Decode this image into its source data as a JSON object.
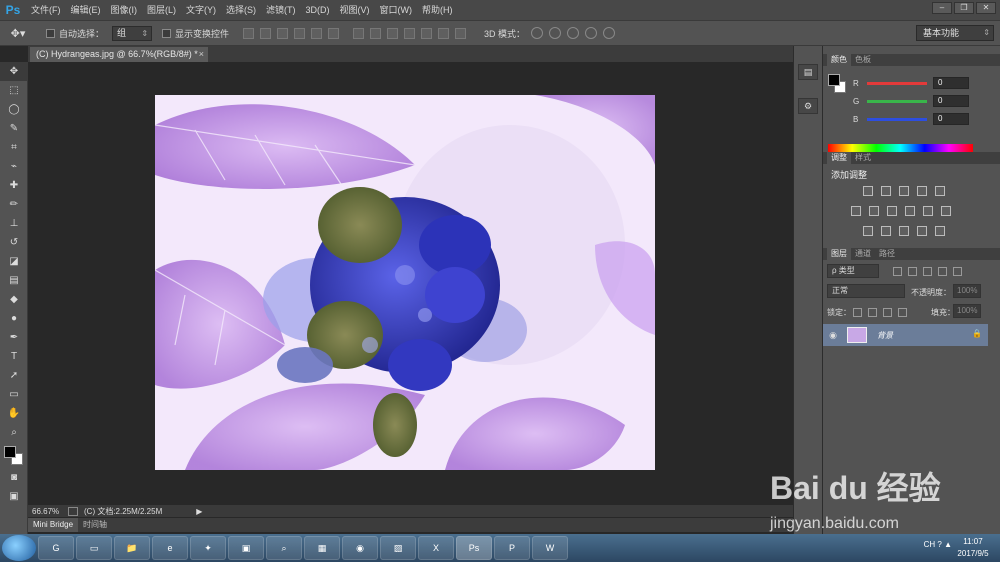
{
  "app": {
    "logo": "Ps",
    "menu": [
      "文件(F)",
      "编辑(E)",
      "图像(I)",
      "图层(L)",
      "文字(Y)",
      "选择(S)",
      "滤镜(T)",
      "3D(D)",
      "视图(V)",
      "窗口(W)",
      "帮助(H)"
    ],
    "window_controls": [
      "–",
      "❐",
      "✕"
    ]
  },
  "options": {
    "auto_select_label": "自动选择：",
    "auto_select_value": "组",
    "show_transform_label": "显示变换控件",
    "mode_3d_label": "3D 模式：",
    "workspace": "基本功能"
  },
  "document": {
    "tab_title": "(C) Hydrangeas.jpg @ 66.7%(RGB/8#) *",
    "close": "×",
    "zoom": "66.67%",
    "doc_info": "(C) 文档:2.25M/2.25M",
    "status_arrow": "▶"
  },
  "bottom_tabs": [
    "Mini Bridge",
    "时间轴"
  ],
  "tools": [
    "move-tool",
    "marquee-tool",
    "lasso-tool",
    "quick-select-tool",
    "crop-tool",
    "eyedropper-tool",
    "healing-tool",
    "brush-tool",
    "stamp-tool",
    "history-brush-tool",
    "eraser-tool",
    "gradient-tool",
    "blur-tool",
    "dodge-tool",
    "pen-tool",
    "type-tool",
    "path-select-tool",
    "rectangle-tool",
    "hand-tool",
    "zoom-tool"
  ],
  "tool_glyphs": [
    "✥",
    "⬚",
    "◯",
    "✎",
    "⌗",
    "⌁",
    "✚",
    "✏",
    "⊥",
    "↺",
    "◪",
    "▤",
    "◆",
    "●",
    "✒",
    "T",
    "➚",
    "▭",
    "✋",
    "⌕"
  ],
  "color_panel": {
    "tabs": [
      "颜色",
      "色板"
    ],
    "sliders": [
      {
        "label": "R",
        "value": "0",
        "color": "#e33a3a"
      },
      {
        "label": "G",
        "value": "0",
        "color": "#39b54a"
      },
      {
        "label": "B",
        "value": "0",
        "color": "#2d4ee0"
      }
    ]
  },
  "adjust_panel": {
    "tabs": [
      "调整",
      "样式"
    ],
    "title": "添加调整"
  },
  "layers_panel": {
    "tabs": [
      "图层",
      "通道",
      "路径"
    ],
    "filter": "ρ 类型",
    "blend_mode": "正常",
    "opacity_label": "不透明度：",
    "opacity_value": "100%",
    "lock_label": "锁定：",
    "fill_label": "填充：",
    "fill_value": "100%",
    "layer_name": "背景"
  },
  "watermark": {
    "brand": "Bai du 经验",
    "url": "jingyan.baidu.com"
  },
  "taskbar": {
    "apps": [
      "G",
      "▭",
      "📁",
      "e",
      "✦",
      "▣",
      "⌕",
      "▦",
      "◉",
      "▨",
      "X",
      "Ps",
      "P",
      "W"
    ],
    "tray": "CH  ?  ▲",
    "time": "11:07",
    "date": "2017/9/5"
  }
}
